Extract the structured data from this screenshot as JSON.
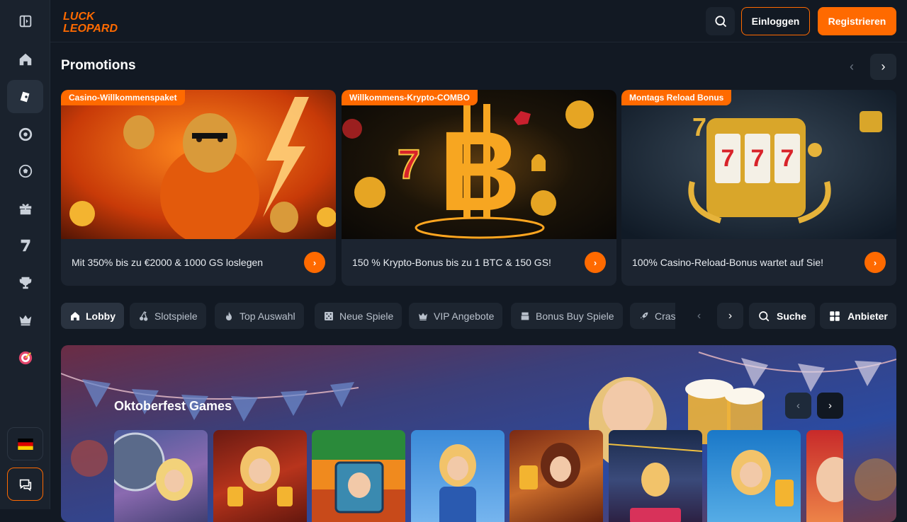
{
  "brand": {
    "logo_line1": "LUCK",
    "logo_line2": "LEOPARD",
    "accent": "#ff6a00"
  },
  "header": {
    "search_icon": "search-icon",
    "login_label": "Einloggen",
    "register_label": "Registrieren"
  },
  "sidebar": {
    "items": [
      {
        "name": "collapse",
        "icon": "sidebar-toggle-icon"
      },
      {
        "name": "home",
        "icon": "home-icon"
      },
      {
        "name": "casino",
        "icon": "cards-icon"
      },
      {
        "name": "live-casino",
        "icon": "roulette-icon"
      },
      {
        "name": "sports",
        "icon": "football-icon"
      },
      {
        "name": "promotions",
        "icon": "gift-icon"
      },
      {
        "name": "slots",
        "icon": "seven-icon"
      },
      {
        "name": "tournaments",
        "icon": "trophy-icon"
      },
      {
        "name": "vip",
        "icon": "crown-icon"
      },
      {
        "name": "challenges",
        "icon": "target-icon"
      }
    ],
    "language": "german-flag-icon",
    "chat": "chat-icon"
  },
  "promotions": {
    "title": "Promotions",
    "cards": [
      {
        "tag": "Casino-Willkommenspaket",
        "text": "Mit 350% bis zu €2000 & 1000 GS loslegen"
      },
      {
        "tag": "Willkommens-Krypto-COMBO",
        "text": "150 % Krypto-Bonus bis zu 1 BTC & 150 GS!"
      },
      {
        "tag": "Montags Reload Bonus",
        "text": "100% Casino-Reload-Bonus wartet auf Sie!"
      }
    ]
  },
  "categories": {
    "items": [
      {
        "label": "Lobby",
        "icon": "home-icon"
      },
      {
        "label": "Slotspiele",
        "icon": "cherries-icon"
      },
      {
        "label": "Top Auswahl",
        "icon": "flame-icon"
      },
      {
        "label": "Neue Spiele",
        "icon": "dice-icon"
      },
      {
        "label": "VIP Angebote",
        "icon": "crown-icon"
      },
      {
        "label": "Bonus Buy Spiele",
        "icon": "slot-machine-icon"
      },
      {
        "label": "Crash",
        "icon": "rocket-icon"
      }
    ],
    "search_label": "Suche",
    "providers_label": "Anbieter"
  },
  "oktoberfest": {
    "title": "Oktoberfest Games",
    "game_count_visible": 8
  }
}
